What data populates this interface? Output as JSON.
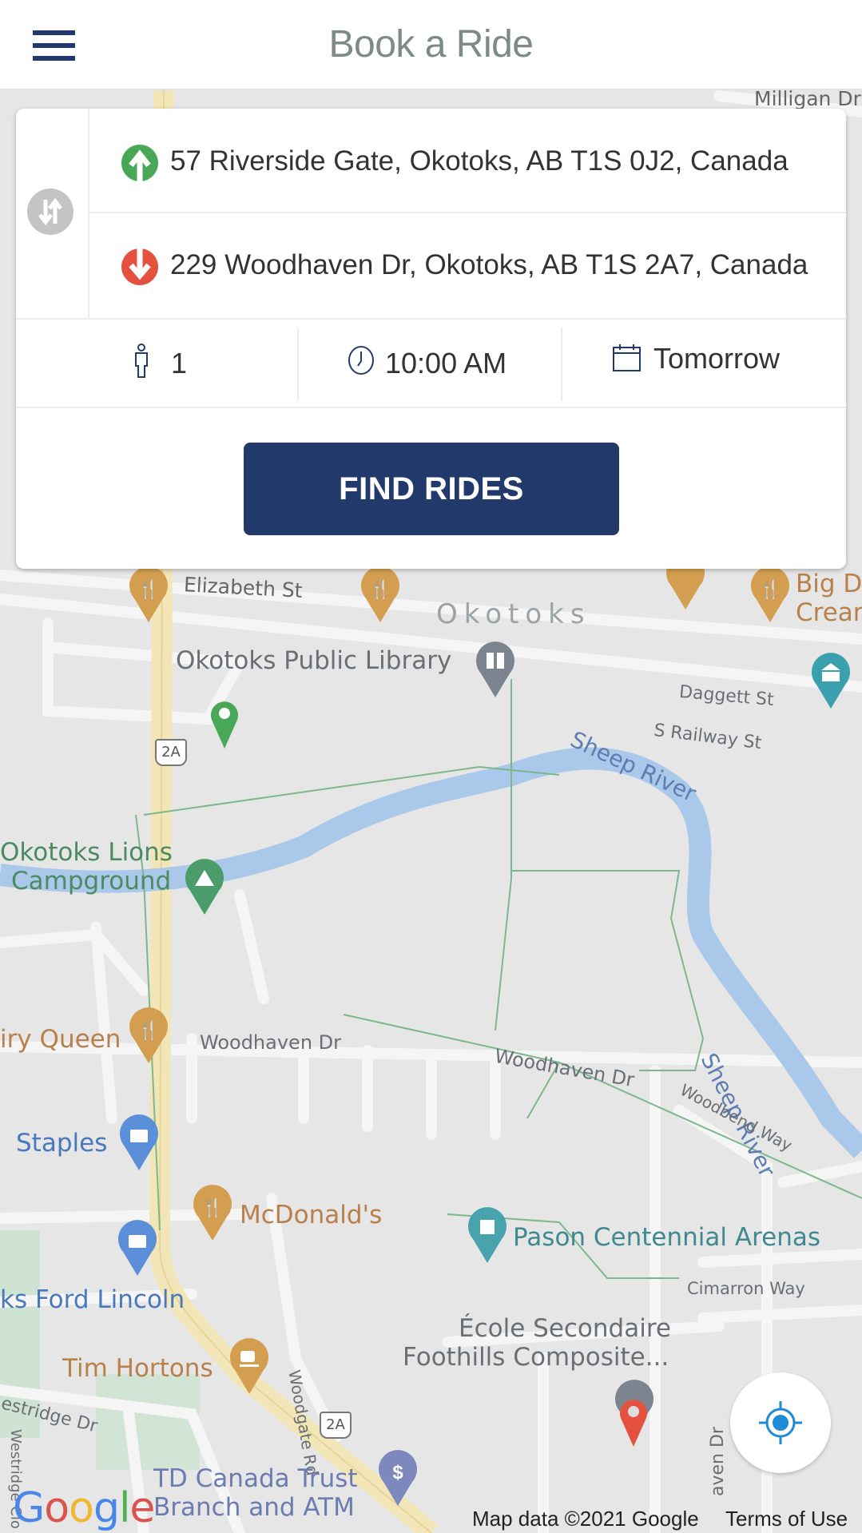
{
  "header": {
    "title": "Book a Ride",
    "menu_icon": "hamburger-menu-icon"
  },
  "booking": {
    "pickup": {
      "icon": "pickup-arrow-up-icon",
      "address": "57 Riverside Gate, Okotoks, AB T1S 0J2, Canada",
      "color": "#48a858"
    },
    "dropoff": {
      "icon": "dropoff-arrow-down-icon",
      "address": "229 Woodhaven Dr, Okotoks, AB T1S 2A7, Canada",
      "color": "#e5513f"
    },
    "swap_icon": "swap-arrows-icon",
    "seats": {
      "icon": "person-icon",
      "value": "1"
    },
    "time": {
      "icon": "clock-icon",
      "value": "10:00 AM"
    },
    "date": {
      "icon": "calendar-icon",
      "value": "Tomorrow"
    },
    "find_button": "FIND RIDES",
    "accent_color": "#213a6b"
  },
  "map": {
    "labels": {
      "milligan": "Milligan Dr",
      "elizabeth": "Elizabeth St",
      "okotoks": "Okotoks",
      "library": "Okotoks Public Library",
      "daggett": "Daggett St",
      "railway": "S Railway St",
      "sheep_river_1": "Sheep River",
      "sheep_river_2": "Sheep River",
      "campground_1": "Okotoks Lions",
      "campground_2": "Campground",
      "dairy_queen": "iry Queen",
      "woodhaven_1": "Woodhaven Dr",
      "woodhaven_2": "Woodhaven Dr",
      "woodbend": "Woodbend Way",
      "staples": "Staples",
      "mcdonalds": "McDonald's",
      "pason": "Pason Centennial Arenas",
      "cimarron": "Cimarron Way",
      "ford": "ks Ford Lincoln",
      "woodgate": "Woodgate Rd",
      "ecole_1": "École Secondaire",
      "ecole_2": "Foothills Composite...",
      "tim_hortons": "Tim Hortons",
      "westridge": "estridge Dr",
      "westridge_v": "Westridge Clo",
      "td_1": "TD Canada Trust",
      "td_2": "Branch and ATM",
      "big_d_1": "Big D",
      "big_d_2": "Crean",
      "highway": "2A",
      "woodhaven_v": "aven Dr"
    },
    "google_logo": "Google",
    "attribution": "Map data ©2021 Google",
    "terms": "Terms of Use",
    "locate_icon": "my-location-crosshair-icon"
  }
}
